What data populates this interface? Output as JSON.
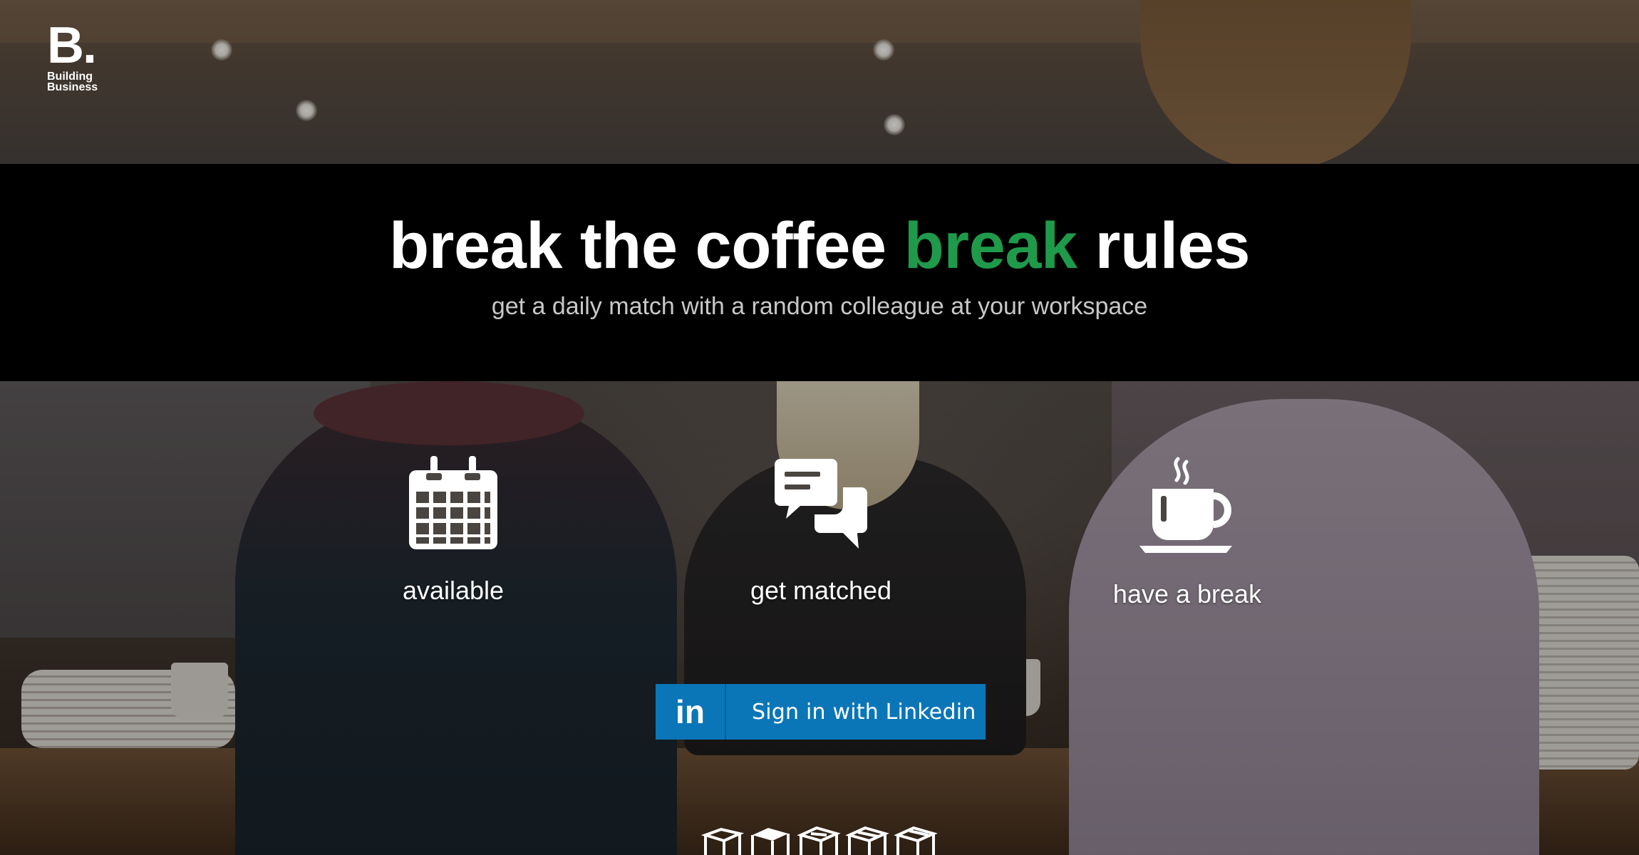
{
  "logo": {
    "mark": "B.",
    "line1": "Building",
    "line2": "Business"
  },
  "hero": {
    "headline_part1": "break the coffee",
    "headline_accent": "break",
    "headline_part2": "rules",
    "subline": "get a daily match with a random colleague at your workspace"
  },
  "steps": [
    {
      "icon": "calendar-icon",
      "label": "available"
    },
    {
      "icon": "chat-bubbles-icon",
      "label": "get matched"
    },
    {
      "icon": "coffee-cup-icon",
      "label": "have a break"
    }
  ],
  "signin": {
    "icon_text": "in",
    "label": "Sign in with Linkedin",
    "color": "#0a76b8"
  },
  "colors": {
    "accent": "#1f9a4a",
    "band": "#000000",
    "text": "#ffffff"
  },
  "bottom_icons": [
    "box-icon-1",
    "box-icon-2",
    "box-icon-3",
    "box-icon-4",
    "box-icon-5"
  ]
}
